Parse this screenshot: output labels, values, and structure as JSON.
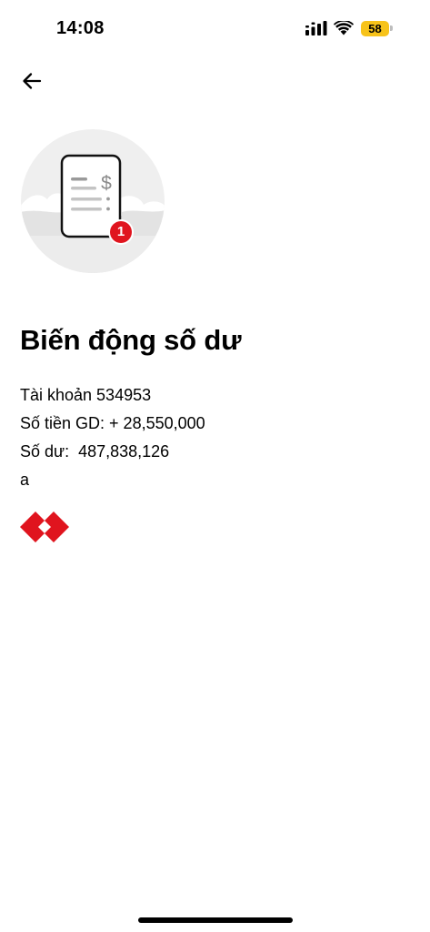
{
  "status_bar": {
    "time": "14:08",
    "battery_level": "58",
    "battery_color": "#f7c31a",
    "signal_icon": "cellular-signal-icon",
    "wifi_icon": "wifi-icon"
  },
  "nav": {
    "back_icon": "arrow-left-icon"
  },
  "illustration": {
    "icon": "receipt-dollar-icon",
    "badge_count": "1",
    "badge_color": "#e0141e"
  },
  "notification": {
    "title": "Biến động số dư",
    "account_line": "Tài khoản 534953",
    "amount_line": "Số tiền GD: + 28,550,000",
    "balance_line": "Số dư:  487,838,126",
    "note_line": "a"
  },
  "brand": {
    "logo_icon": "bank-logo-icon",
    "logo_color": "#e0141e"
  }
}
